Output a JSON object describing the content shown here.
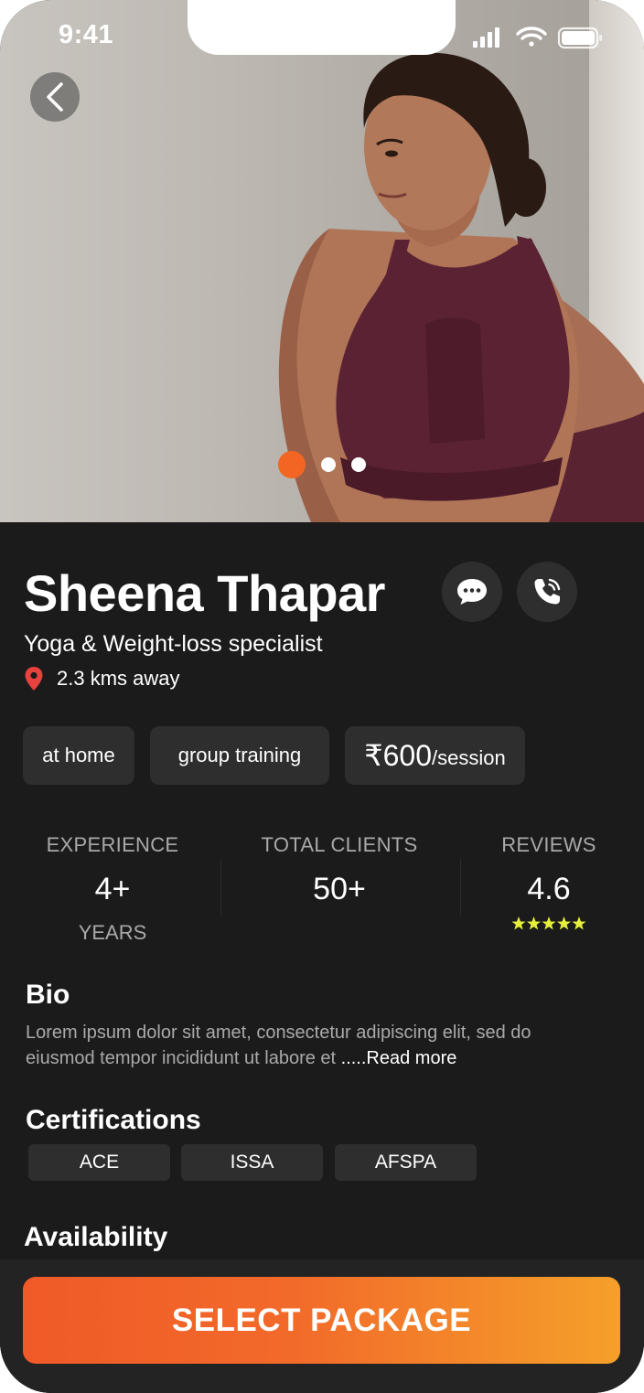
{
  "status_bar": {
    "time": "9:41"
  },
  "hero": {
    "carousel_count": 3,
    "carousel_active_index": 0
  },
  "trainer": {
    "name": "Sheena Thapar",
    "specialty": "Yoga & Weight-loss specialist",
    "distance": "2.3 kms away"
  },
  "tags": {
    "at_home": "at home",
    "group_training": "group training",
    "price": "₹600",
    "price_unit": "/session"
  },
  "stats": {
    "experience": {
      "label": "EXPERIENCE",
      "value": "4+",
      "unit": "YEARS"
    },
    "clients": {
      "label": "TOTAL CLIENTS",
      "value": "50+"
    },
    "reviews": {
      "label": "REVIEWS",
      "value": "4.6",
      "stars": 5
    }
  },
  "bio": {
    "title": "Bio",
    "text": "Lorem ipsum dolor sit amet, consectetur adipiscing elit, sed do eiusmod tempor incididunt ut labore et ",
    "read_more": ".....Read more"
  },
  "certifications": {
    "title": "Certifications",
    "items": [
      "ACE",
      "ISSA",
      "AFSPA"
    ]
  },
  "availability": {
    "title": "Availability"
  },
  "cta": {
    "label": "SELECT PACKAGE"
  },
  "colors": {
    "accent": "#f26522",
    "background": "#1b1b1b",
    "chip": "#2e2e2e",
    "star": "#e6f03c",
    "pin": "#e8413e"
  },
  "icons": [
    "chevron-left-icon",
    "chat-bubble-icon",
    "phone-call-icon",
    "location-pin-icon",
    "star-icon",
    "signal-icon",
    "wifi-icon",
    "battery-icon"
  ]
}
